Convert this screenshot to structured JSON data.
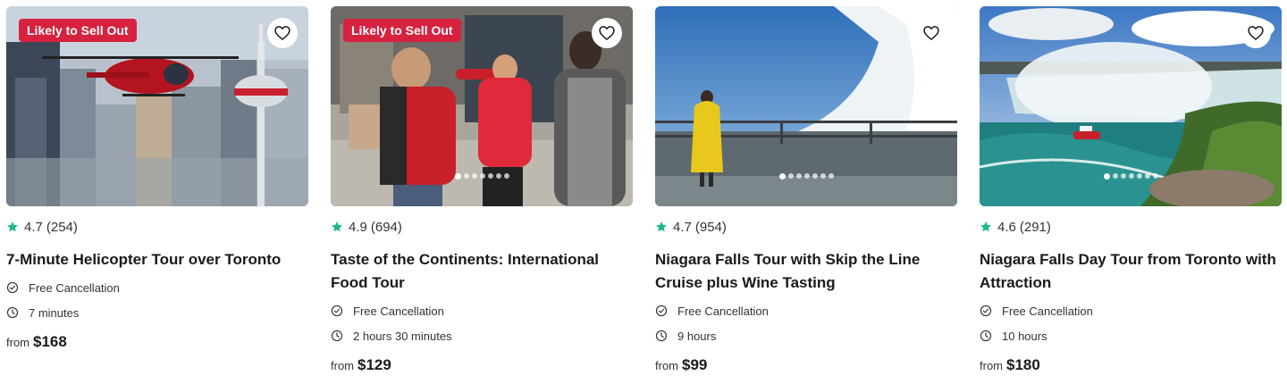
{
  "cards": [
    {
      "badge": "Likely to Sell Out",
      "rating": "4.7",
      "reviews": "(254)",
      "title": "7-Minute Helicopter Tour over Toronto",
      "feature": "Free Cancellation",
      "duration": "7 minutes",
      "price_prefix": "from",
      "price": "$168"
    },
    {
      "badge": "Likely to Sell Out",
      "rating": "4.9",
      "reviews": "(694)",
      "title": "Taste of the Continents: International Food Tour",
      "feature": "Free Cancellation",
      "duration": "2 hours 30 minutes",
      "price_prefix": "from",
      "price": "$129"
    },
    {
      "rating": "4.7",
      "reviews": "(954)",
      "title": "Niagara Falls Tour with Skip the Line Cruise plus Wine Tasting",
      "feature": "Free Cancellation",
      "duration": "9 hours",
      "price_prefix": "from",
      "price": "$99"
    },
    {
      "rating": "4.6",
      "reviews": "(291)",
      "title": "Niagara Falls Day Tour from Toronto with Attraction",
      "feature": "Free Cancellation",
      "duration": "10 hours",
      "price_prefix": "from",
      "price": "$180"
    }
  ],
  "icons": {
    "rating": "star-icon",
    "wishlist": "heart-icon",
    "cancellation": "check-circle-icon",
    "duration": "clock-icon"
  },
  "colors": {
    "badge": "#d6223f",
    "star": "#1fb88c",
    "text": "#1a1a1a"
  }
}
